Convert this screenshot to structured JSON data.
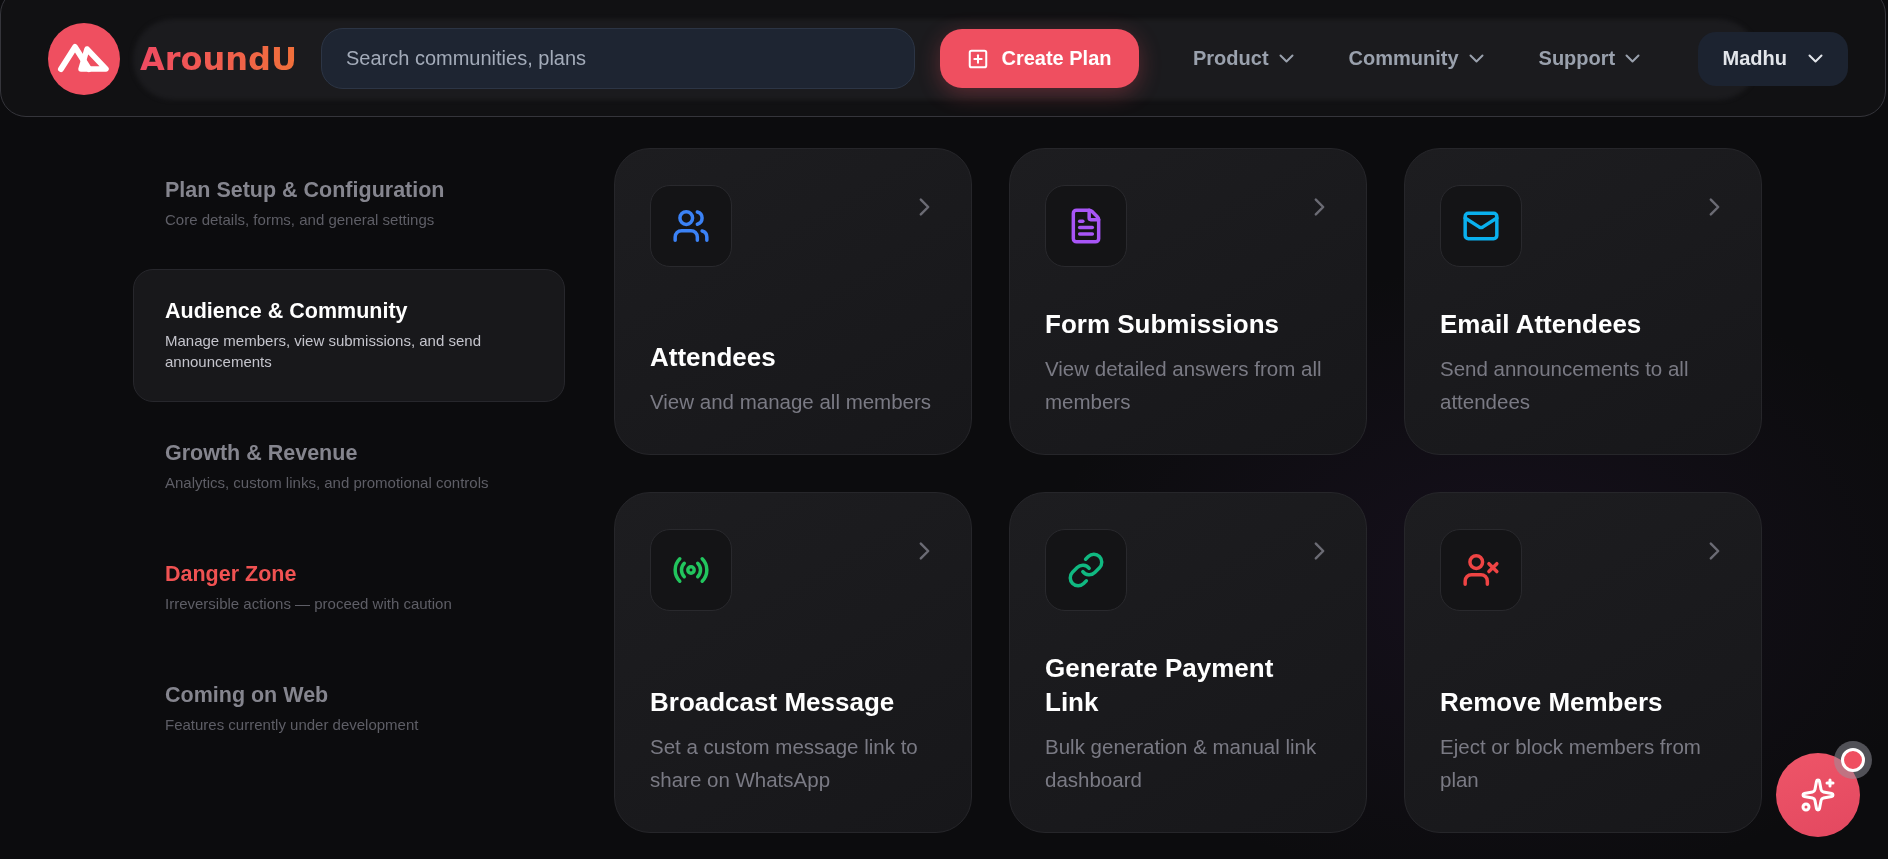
{
  "header": {
    "logo_text": "AroundU",
    "search": {
      "placeholder": "Search communities, plans"
    },
    "create_button": "Create Plan",
    "nav": [
      "Product",
      "Community",
      "Support"
    ],
    "user_menu": "Madhu"
  },
  "sidebar": {
    "items": [
      {
        "title": "Plan Setup & Configuration",
        "description": "Core details, forms, and general settings",
        "selected": false,
        "kind": "default"
      },
      {
        "title": "Audience & Community",
        "description": "Manage members, view submissions, and send announcements",
        "selected": true,
        "kind": "default"
      },
      {
        "title": "Growth & Revenue",
        "description": "Analytics, custom links, and promotional controls",
        "selected": false,
        "kind": "default"
      },
      {
        "title": "Danger Zone",
        "description": "Irreversible actions — proceed with caution",
        "selected": false,
        "kind": "danger"
      },
      {
        "title": "Coming on Web",
        "description": "Features currently under development",
        "selected": false,
        "kind": "default"
      }
    ]
  },
  "cards": [
    {
      "title": "Attendees",
      "description": "View and manage all members",
      "color": "#3b82f6"
    },
    {
      "title": "Form Submissions",
      "description": "View detailed answers from all members",
      "color": "#a855f7"
    },
    {
      "title": "Email Attendees",
      "description": "Send announcements to all attendees",
      "color": "#0ab0ee"
    },
    {
      "title": "Broadcast Message",
      "description": "Set a custom message link to share on WhatsApp",
      "color": "#22c55e"
    },
    {
      "title": "Generate Payment Link",
      "description": "Bulk generation & manual link dashboard",
      "color": "#10b981"
    },
    {
      "title": "Remove Members",
      "description": "Eject or block members from plan",
      "color": "#ef4444"
    }
  ],
  "assistant": {
    "notification": true
  }
}
